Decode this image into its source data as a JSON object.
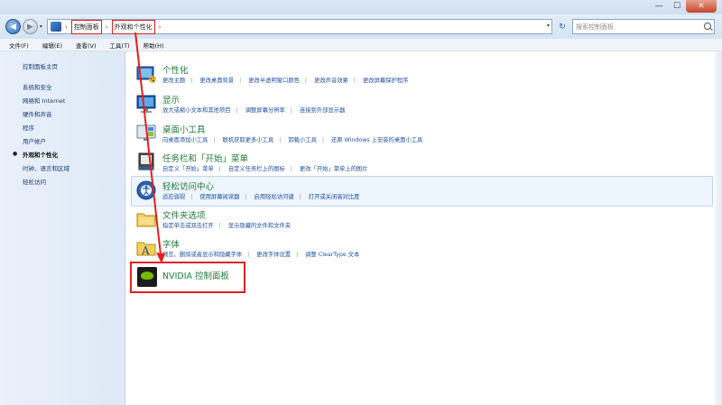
{
  "window": {
    "minimize_glyph": "—",
    "maximize_glyph": "☐",
    "close_glyph": "✕"
  },
  "address": {
    "crumbs": [
      "控制面板",
      "外观和个性化"
    ],
    "search_placeholder": "搜索控制面板"
  },
  "menubar": {
    "items": [
      "文件(F)",
      "编辑(E)",
      "查看(V)",
      "工具(T)",
      "帮助(H)"
    ]
  },
  "sidebar": {
    "items": [
      {
        "label": "控制面板主页",
        "current": false
      },
      {
        "label": "系统和安全",
        "current": false
      },
      {
        "label": "网络和 Internet",
        "current": false
      },
      {
        "label": "硬件和声音",
        "current": false
      },
      {
        "label": "程序",
        "current": false
      },
      {
        "label": "用户帐户",
        "current": false
      },
      {
        "label": "外观和个性化",
        "current": true
      },
      {
        "label": "时钟、语言和区域",
        "current": false
      },
      {
        "label": "轻松访问",
        "current": false
      }
    ]
  },
  "categories": [
    {
      "title": "个性化",
      "icon": "personalization-icon",
      "links": [
        "更改主题",
        "更改桌面背景",
        "更改半透明窗口颜色",
        "更改声音效果",
        "更改屏幕保护程序"
      ]
    },
    {
      "title": "显示",
      "icon": "display-icon",
      "links": [
        "放大或缩小文本和其他项目",
        "调整屏幕分辨率",
        "连接到外部显示器"
      ]
    },
    {
      "title": "桌面小工具",
      "icon": "gadgets-icon",
      "links": [
        "向桌面添加小工具",
        "联机获取更多小工具",
        "卸载小工具",
        "还原 Windows 上安装的桌面小工具"
      ]
    },
    {
      "title": "任务栏和「开始」菜单",
      "icon": "taskbar-icon",
      "links": [
        "自定义「开始」菜单",
        "自定义任务栏上的图标",
        "更改「开始」菜单上的图片"
      ]
    },
    {
      "title": "轻松访问中心",
      "icon": "ease-of-access-icon",
      "links": [
        "适应弱视",
        "使用屏幕阅读器",
        "启用轻松访问键",
        "打开或关闭高对比度"
      ]
    },
    {
      "title": "文件夹选项",
      "icon": "folder-options-icon",
      "links": [
        "指定单击或双击打开",
        "显示隐藏的文件和文件夹"
      ]
    },
    {
      "title": "字体",
      "icon": "fonts-icon",
      "links": [
        "预览、删除或者显示和隐藏字体",
        "更改字体设置",
        "调整 ClearType 文本"
      ]
    }
  ],
  "nvidia": {
    "title": "NVIDIA 控制面板",
    "icon": "nvidia-icon"
  },
  "colors": {
    "title_green": "#1f7a3a",
    "link_blue": "#1e50a2",
    "annotation_red": "#e02020"
  }
}
